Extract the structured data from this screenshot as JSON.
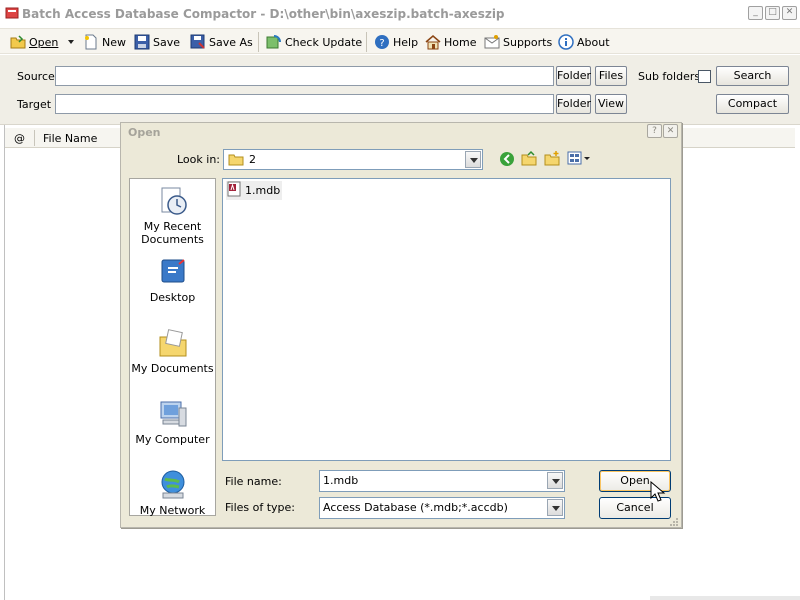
{
  "window": {
    "title": "Batch Access Database Compactor - D:\\other\\bin\\axeszip.batch-axeszip",
    "controls": [
      "_",
      "□",
      "✕"
    ]
  },
  "toolbar": {
    "items": [
      {
        "label": "Open",
        "icon": "open-folder-icon"
      },
      {
        "label": "New",
        "icon": "new-document-icon"
      },
      {
        "label": "Save",
        "icon": "floppy-disk-icon"
      },
      {
        "label": "Save As",
        "icon": "save-as-icon"
      },
      {
        "label": "Check Update",
        "icon": "check-update-icon"
      },
      {
        "label": "Help",
        "icon": "help-icon"
      },
      {
        "label": "Home",
        "icon": "home-icon"
      },
      {
        "label": "Supports",
        "icon": "supports-icon"
      },
      {
        "label": "About",
        "icon": "about-icon"
      }
    ]
  },
  "fields": {
    "source_label": "Source",
    "source_value": "",
    "target_label": "Target",
    "target_value": "",
    "folder_label": "Folder",
    "files_label": "Files",
    "view_label": "View",
    "subfolders_label": "Sub folders",
    "subfolders_checked": false,
    "search_label": "Search",
    "compact_label": "Compact"
  },
  "list": {
    "columns": [
      "@",
      "File Name"
    ]
  },
  "dialog": {
    "title": "Open",
    "title_buttons": [
      "?",
      "✕"
    ],
    "lookin_label": "Look in:",
    "lookin_value": "2",
    "places": [
      {
        "label": "My Recent Documents",
        "icon": "recent-documents-icon"
      },
      {
        "label": "Desktop",
        "icon": "desktop-icon"
      },
      {
        "label": "My Documents",
        "icon": "my-documents-icon"
      },
      {
        "label": "My Computer",
        "icon": "my-computer-icon"
      },
      {
        "label": "My Network",
        "icon": "my-network-icon"
      }
    ],
    "files": [
      {
        "name": "1.mdb",
        "icon": "access-database-icon"
      }
    ],
    "filename_label": "File name:",
    "filename_value": "1.mdb",
    "filetype_label": "Files of type:",
    "filetype_value": "Access Database (*.mdb;*.accdb)",
    "open_label": "Open",
    "cancel_label": "Cancel"
  },
  "colors": {
    "dialog_bg": "#ece9d8",
    "input_border": "#7f9db9",
    "toolbar_bg": "#f7f5ef"
  }
}
